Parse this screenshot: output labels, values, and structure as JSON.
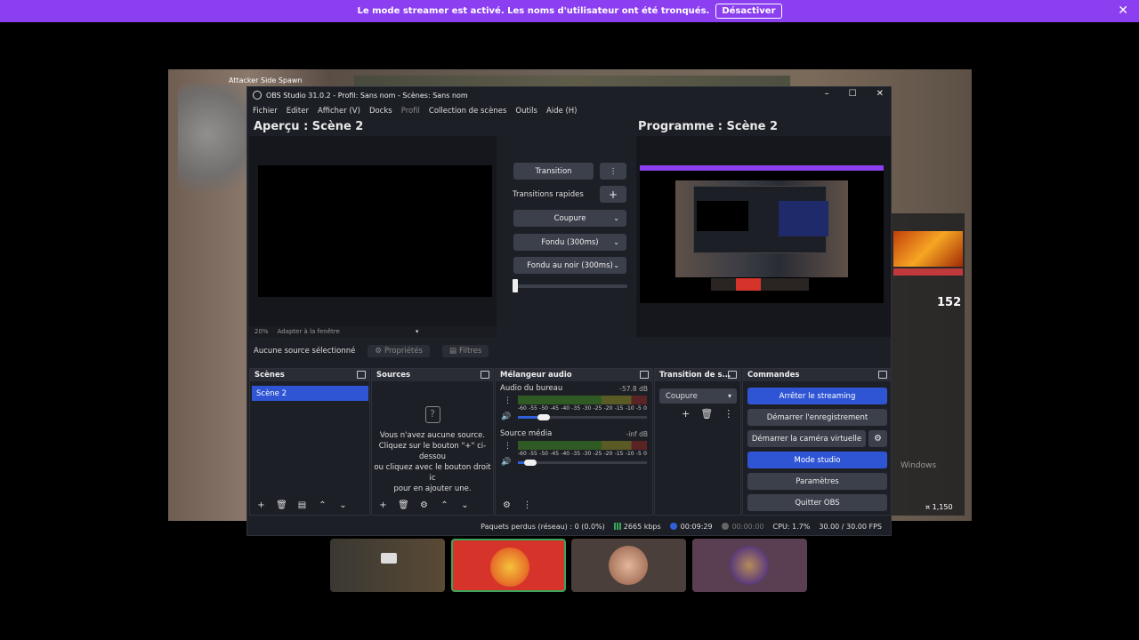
{
  "streamer_bar": {
    "message": "Le mode streamer est activé. Les noms d'utilisateur ont été tronqués.",
    "button": "Désactiver",
    "color": "#8b3ff0"
  },
  "game": {
    "map_label": "Attacker Side Spawn",
    "hud_value": "152",
    "money": "¤ 1,150",
    "watermark": "Windows"
  },
  "obs": {
    "title": "OBS Studio 31.0.2 - Profil: Sans nom - Scènes: Sans nom",
    "menu": [
      "Fichier",
      "Editer",
      "Afficher (V)",
      "Docks",
      "Profil",
      "Collection de scènes",
      "Outils",
      "Aide (H)"
    ],
    "preview_title": "Aperçu : Scène 2",
    "program_title": "Programme : Scène 2",
    "zoom": "20%",
    "fit_label": "Adapter à la fenêtre",
    "transition_button": "Transition",
    "quick_transitions_label": "Transitions rapides",
    "quick_transitions": [
      "Coupure",
      "Fondu (300ms)",
      "Fondu au noir (300ms)"
    ],
    "no_source": "Aucune source sélectionné",
    "properties_button": "Propriétés",
    "filters_button": "Filtres",
    "docks": {
      "scenes": {
        "title": "Scènes",
        "items": [
          "Scène 2"
        ]
      },
      "sources": {
        "title": "Sources",
        "empty_line1": "Vous n'avez aucune source.",
        "empty_line2": "Cliquez sur le bouton \"+\" ci-dessou",
        "empty_line3": "ou cliquez avec le bouton droit ic",
        "empty_line4": "pour en ajouter une."
      },
      "mixer": {
        "title": "Mélangeur audio",
        "channels": [
          {
            "name": "Audio du bureau",
            "db": "-57.8 dB",
            "volume": 0.15
          },
          {
            "name": "Source média",
            "db": "-inf dB",
            "volume": 0.05
          }
        ],
        "scale": [
          "-60",
          "-55",
          "-50",
          "-45",
          "-40",
          "-35",
          "-30",
          "-25",
          "-20",
          "-15",
          "-10",
          "-5",
          "0"
        ]
      },
      "transition": {
        "title": "Transition de s...",
        "selected": "Coupure"
      },
      "controls": {
        "title": "Commandes",
        "buttons": [
          "Arrêter le streaming",
          "Démarrer l'enregistrement",
          "Démarrer la caméra virtuelle",
          "Mode studio",
          "Paramètres",
          "Quitter OBS"
        ]
      }
    },
    "status": {
      "dropped": "Paquets perdus (réseau) : 0 (0.0%)",
      "bitrate": "2665 kbps",
      "stream_time": "00:09:29",
      "rec_time": "00:00:00",
      "cpu": "CPU: 1.7%",
      "fps": "30.00 / 30.00 FPS"
    },
    "accent": "#2f55d4"
  }
}
